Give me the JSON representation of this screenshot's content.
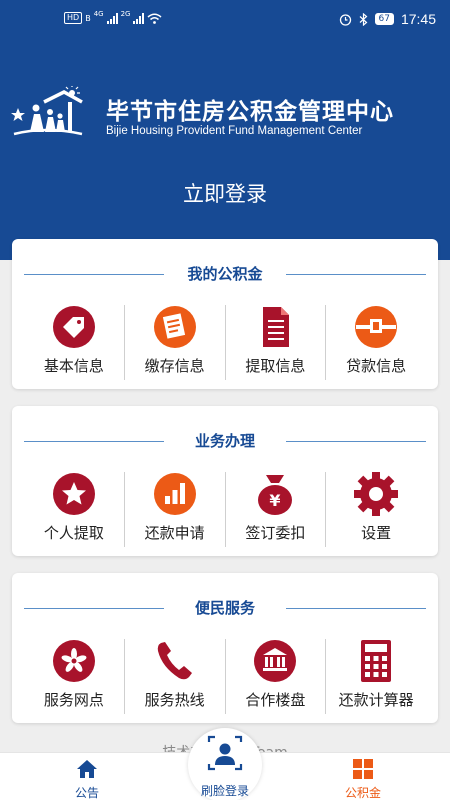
{
  "status_bar": {
    "left_badge": "HD",
    "left_badge_2": "B",
    "net1": "4G",
    "net2": "2G",
    "battery": "67",
    "time": "17:45"
  },
  "header": {
    "title_cn": "毕节市住房公积金管理中心",
    "title_en": "Bijie Housing Provident Fund Management Center",
    "login_link": "立即登录"
  },
  "sections": [
    {
      "title": "我的公积金",
      "items": [
        {
          "label": "基本信息",
          "icon": "tag-icon"
        },
        {
          "label": "缴存信息",
          "icon": "document-list-icon"
        },
        {
          "label": "提取信息",
          "icon": "file-icon"
        },
        {
          "label": "贷款信息",
          "icon": "loan-icon"
        }
      ]
    },
    {
      "title": "业务办理",
      "items": [
        {
          "label": "个人提取",
          "icon": "star-icon"
        },
        {
          "label": "还款申请",
          "icon": "bar-chart-icon"
        },
        {
          "label": "签订委扣",
          "icon": "money-bag-icon"
        },
        {
          "label": "设置",
          "icon": "gear-icon"
        }
      ]
    },
    {
      "title": "便民服务",
      "items": [
        {
          "label": "服务网点",
          "icon": "flower-icon"
        },
        {
          "label": "服务热线",
          "icon": "phone-icon"
        },
        {
          "label": "合作楼盘",
          "icon": "building-icon"
        },
        {
          "label": "还款计算器",
          "icon": "calculator-icon"
        }
      ]
    }
  ],
  "footer": {
    "tech_support": "技术支持：  A Team"
  },
  "bottom_nav": {
    "home_label": "公告",
    "scan_label": "刷脸登录",
    "fund_label": "公积金"
  },
  "colors": {
    "brand_blue": "#174a94",
    "icon_red": "#a8132b",
    "icon_orange": "#ec5a16"
  }
}
